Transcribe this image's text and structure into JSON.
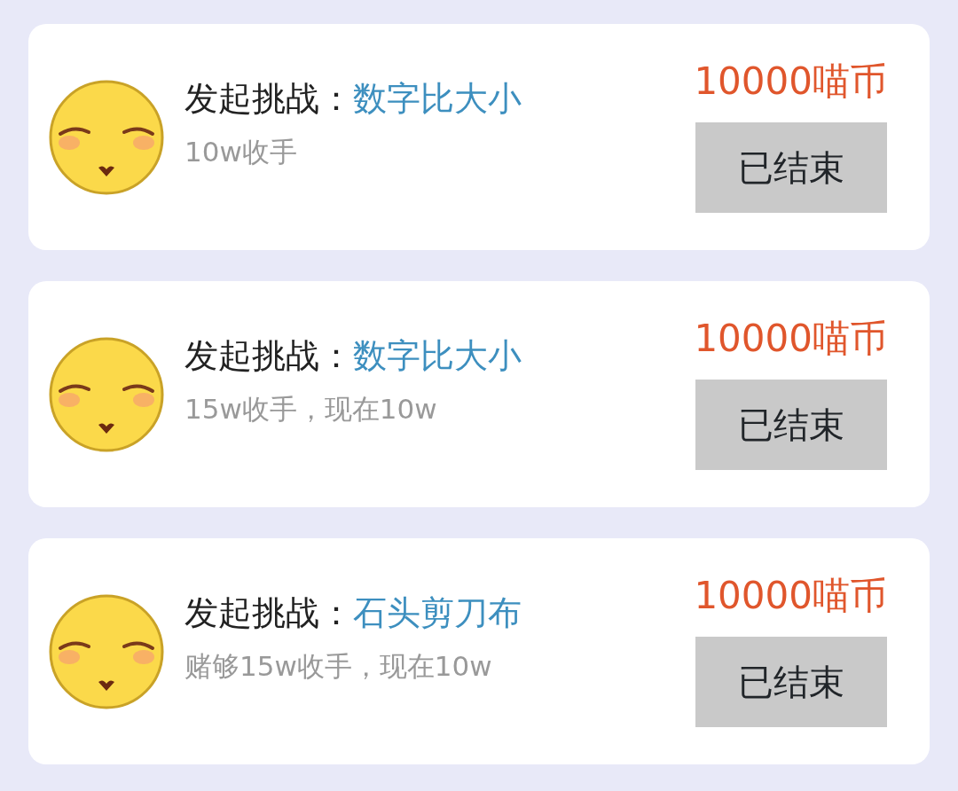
{
  "challenges": [
    {
      "label": "发起挑战：",
      "game": "数字比大小",
      "note": "10w收手",
      "price": "10000喵币",
      "button": {
        "text": "已结束",
        "disabled": true
      }
    },
    {
      "label": "发起挑战：",
      "game": "数字比大小",
      "note": "15w收手，现在10w",
      "price": "10000喵币",
      "button": {
        "text": "已结束",
        "disabled": true
      }
    },
    {
      "label": "发起挑战：",
      "game": "石头剪刀布",
      "note": "赌够15w收手，现在10w",
      "price": "10000喵币",
      "button": {
        "text": "已结束",
        "disabled": true
      }
    }
  ]
}
